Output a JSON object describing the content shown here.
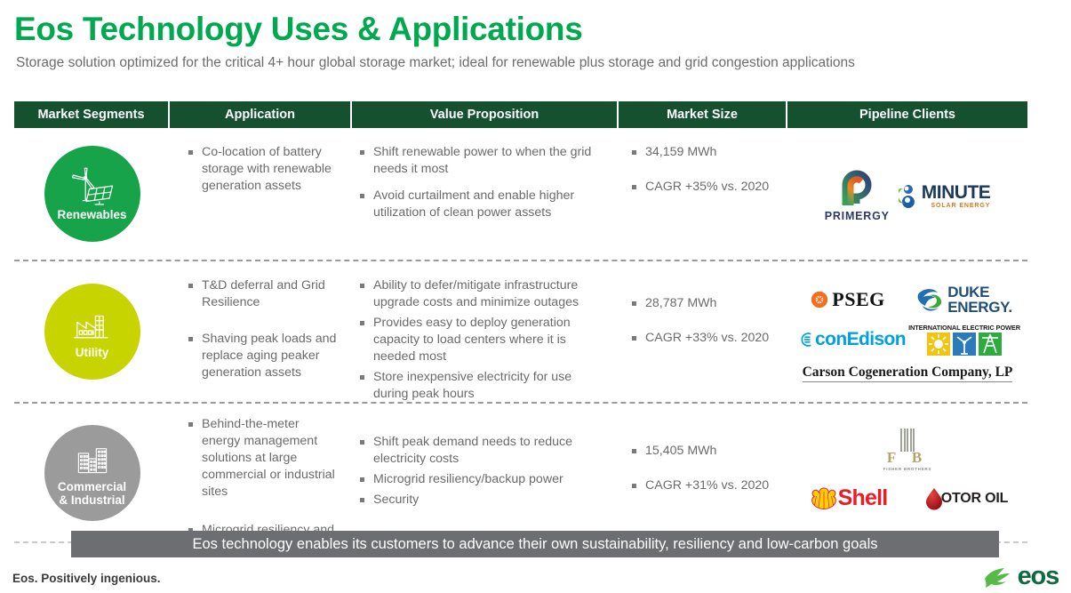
{
  "header": {
    "title": "Eos Technology Uses & Applications",
    "subtitle": "Storage solution optimized for the critical 4+ hour global storage market; ideal for renewable plus storage and grid congestion applications",
    "title_color": "#00a94f"
  },
  "table": {
    "columns": [
      {
        "label": "Market Segments"
      },
      {
        "label": "Application"
      },
      {
        "label": "Value Proposition"
      },
      {
        "label": "Market Size"
      },
      {
        "label": "Pipeline Clients"
      }
    ],
    "header_bg": "#15502f",
    "rows": [
      {
        "segment": {
          "label": "Renewables",
          "color": "#16a34a",
          "icon": "wind-turbine-solar-panel-icon"
        },
        "application": [
          "Co-location of battery storage with renewable generation assets"
        ],
        "value_proposition": [
          "Shift renewable power to when the grid needs it most",
          "Avoid curtailment and enable higher utilization of clean power assets"
        ],
        "market_size": [
          "34,159 MWh",
          "CAGR +35% vs. 2020"
        ],
        "clients": [
          {
            "name": "Primergy",
            "wordmark": "PRIMERGY"
          },
          {
            "name": "8minute Solar Energy",
            "wordmark": "MINUTE",
            "subtext": "SOLAR ENERGY"
          }
        ]
      },
      {
        "segment": {
          "label": "Utility",
          "color": "#c8d400",
          "icon": "factory-icon"
        },
        "application": [
          "T&D deferral and Grid Resilience",
          "Shaving peak loads and replace aging peaker generation assets"
        ],
        "value_proposition": [
          "Ability to defer/mitigate infrastructure upgrade costs and minimize outages",
          "Provides easy to deploy generation capacity to load centers where it is needed most",
          "Store inexpensive electricity for use during peak hours"
        ],
        "market_size": [
          "28,787 MWh",
          "CAGR +33% vs. 2020"
        ],
        "clients": [
          {
            "name": "PSEG",
            "wordmark": "PSEG"
          },
          {
            "name": "Duke Energy",
            "wordmark": "DUKE",
            "wordmark2": "ENERGY."
          },
          {
            "name": "conEdison",
            "wordmark": "conEdison"
          },
          {
            "name": "International Electric Power",
            "wordmark": "INTERNATIONAL ELECTRIC POWER"
          },
          {
            "name": "Carson Cogeneration Company, LP",
            "wordmark": "Carson Cogeneration Company, LP"
          }
        ]
      },
      {
        "segment": {
          "label": "Commercial",
          "label2": "& Industrial",
          "color": "#9b9b9b",
          "icon": "city-buildings-icon"
        },
        "application": [
          "Behind-the-meter energy management solutions at large commercial or industrial sites",
          "Microgrid resiliency and peak shifting"
        ],
        "value_proposition": [
          "Shift peak demand needs to reduce electricity costs",
          "Microgrid resiliency/backup power",
          "Security"
        ],
        "market_size": [
          "15,405 MWh",
          "CAGR +31% vs. 2020"
        ],
        "clients": [
          {
            "name": "Fisher Brothers",
            "wordmark": "F  B",
            "subtext": "FISHER BROTHERS"
          },
          {
            "name": "Shell",
            "wordmark": "Shell"
          },
          {
            "name": "Motor Oil",
            "wordmark": "OTOR OIL"
          }
        ]
      }
    ]
  },
  "footer": {
    "banner": "Eos technology enables its customers to advance their own sustainability, resiliency and low-carbon goals",
    "banner_bg": "#6d6e71",
    "tagline": "Eos. Positively ingenious.",
    "brand": "eos",
    "brand_color": "#0f6b3f"
  }
}
